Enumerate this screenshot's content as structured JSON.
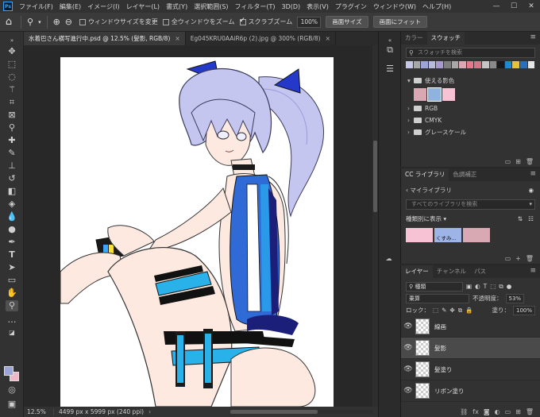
{
  "app": {
    "logo": "Ps",
    "menu": [
      "ファイル(F)",
      "編集(E)",
      "イメージ(I)",
      "レイヤー(L)",
      "書式(Y)",
      "選択範囲(S)",
      "フィルター(T)",
      "3D(D)",
      "表示(V)",
      "プラグイン",
      "ウィンドウ(W)",
      "ヘルプ(H)"
    ],
    "window_controls": [
      "—",
      "☐",
      "✕"
    ]
  },
  "options_bar": {
    "tool_icon": "zoom-icon",
    "check_resize_windows": "ウィンドウサイズを変更",
    "check_zoom_all": "全ウィンドウをズーム",
    "check_scrubby_zoom": "スクラブズーム",
    "scrubby_checked": true,
    "zoom_value": "100%",
    "fit_screen_button": "画面サイズ",
    "fill_screen_button": "画面にフィット"
  },
  "doc_tabs": [
    {
      "label": "水着巴さん横写進行中.psd @ 12.5% (髪影, RGB/8)",
      "active": true
    },
    {
      "label": "Eg045KRU0AAiR6p (2).jpg @ 300% (RGB/8)",
      "active": false
    }
  ],
  "status": {
    "zoom": "12.5%",
    "dimensions": "4499 px x 5999 px (240 ppi)",
    "arrow": "›"
  },
  "colors": {
    "foreground": "#9da4d8",
    "background": "#f0b7c6",
    "accent": "#31a8ff"
  },
  "swatches_panel": {
    "tabs": [
      "カラー",
      "スウォッチ"
    ],
    "search_placeholder": "スウォッチを検索",
    "recent": [
      "#c6c7e8",
      "#a7a7a7",
      "#9da4d8",
      "#b7bbdb",
      "#a89ad0",
      "#7e7e7e",
      "#a9a9a9",
      "#d9a9b3",
      "#e17b8c",
      "#cf7a86",
      "#c6c6c6",
      "#8a8a8a",
      "#1a1a1a",
      "#1e88d2",
      "#e0c53a",
      "#2a6fb7",
      "#e6e6e6"
    ],
    "groups": [
      {
        "name": "使える影色",
        "open": true,
        "colors": [
          "#d9a9b3",
          "#8fb2df",
          "#f6c2d4"
        ]
      },
      {
        "name": "RGB",
        "open": false
      },
      {
        "name": "CMYK",
        "open": false
      },
      {
        "name": "グレースケール",
        "open": false
      }
    ]
  },
  "library_panel": {
    "tabs": [
      "CC ライブラリ",
      "色調補正"
    ],
    "library_name": "マイライブラリ",
    "search_placeholder": "すべてのライブラリを検索",
    "view_label": "種類別に表示",
    "swatch_label": "くすみ...",
    "items": [
      "#f6c2d4",
      "#9fb4e6",
      "#d9a9b3"
    ]
  },
  "layers_panel": {
    "tabs": [
      "レイヤー",
      "チャンネル",
      "パス"
    ],
    "filter_kind": "種類",
    "blend_mode": "乗算",
    "opacity_label": "不透明度：",
    "opacity_value": "53%",
    "lock_label": "ロック：",
    "fill_label": "塗り：",
    "fill_value": "100%",
    "layers": [
      {
        "name": "線画",
        "selected": false
      },
      {
        "name": "髪影",
        "selected": true
      },
      {
        "name": "髪塗り",
        "selected": false
      },
      {
        "name": "リボン塗り",
        "selected": false
      }
    ]
  }
}
